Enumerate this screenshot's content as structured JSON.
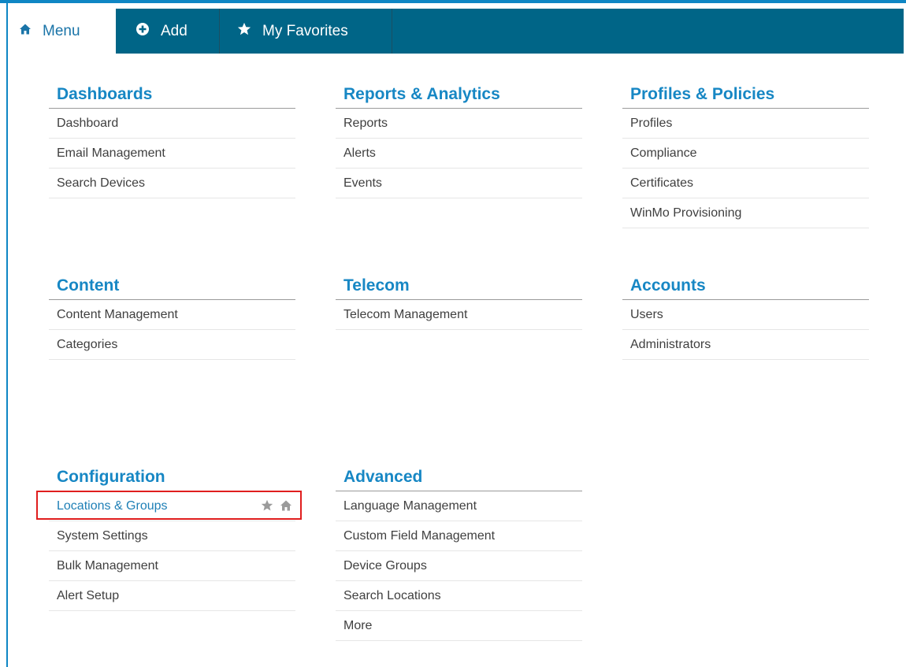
{
  "nav": {
    "tabs": [
      {
        "label": "Menu",
        "icon": "home-icon"
      },
      {
        "label": "Add",
        "icon": "plus-circle-icon"
      },
      {
        "label": "My Favorites",
        "icon": "star-icon"
      }
    ]
  },
  "sections": {
    "dashboards": {
      "title": "Dashboards",
      "items": [
        "Dashboard",
        "Email Management",
        "Search Devices"
      ]
    },
    "reports": {
      "title": "Reports & Analytics",
      "items": [
        "Reports",
        "Alerts",
        "Events"
      ]
    },
    "profiles": {
      "title": "Profiles & Policies",
      "items": [
        "Profiles",
        "Compliance",
        "Certificates",
        "WinMo Provisioning"
      ]
    },
    "content": {
      "title": "Content",
      "items": [
        "Content Management",
        "Categories"
      ]
    },
    "telecom": {
      "title": "Telecom",
      "items": [
        "Telecom Management"
      ]
    },
    "accounts": {
      "title": "Accounts",
      "items": [
        "Users",
        "Administrators"
      ]
    },
    "configuration": {
      "title": "Configuration",
      "items": [
        "Locations & Groups",
        "System Settings",
        "Bulk Management",
        "Alert Setup"
      ]
    },
    "advanced": {
      "title": "Advanced",
      "items": [
        "Language Management",
        "Custom Field Management",
        "Device Groups",
        "Search Locations",
        "More"
      ]
    }
  },
  "hover_item_actions": [
    "favorite-star-icon",
    "set-home-icon"
  ],
  "colors": {
    "nav_bg": "#006587",
    "section_title": "#1787c4",
    "item_text": "#3f3f3f",
    "active_item": "#1e7fb6",
    "highlight_border": "#e01e1e"
  }
}
